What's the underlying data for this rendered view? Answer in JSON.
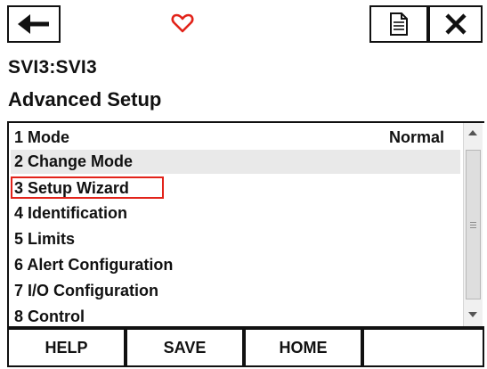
{
  "toolbar": {
    "back_icon": "left-arrow-icon",
    "favorite_icon": "heart-outline-icon",
    "favorite_color": "#e2231a",
    "document_icon": "document-icon",
    "close_icon": "close-x-icon"
  },
  "device_name": "SVI3:SVI3",
  "page_title": "Advanced Setup",
  "menu": {
    "items": [
      {
        "label": "1 Mode",
        "value": "Normal"
      },
      {
        "label": "2 Change Mode",
        "value": ""
      },
      {
        "label": "3 Setup Wizard",
        "value": ""
      },
      {
        "label": "4 Identification",
        "value": ""
      },
      {
        "label": "5 Limits",
        "value": ""
      },
      {
        "label": "6 Alert Configuration",
        "value": ""
      },
      {
        "label": "7 I/O Configuration",
        "value": ""
      },
      {
        "label": "8 Control",
        "value": ""
      }
    ],
    "highlighted_index": 2,
    "highlight_color": "#e2231a"
  },
  "footer": {
    "help_label": "HELP",
    "save_label": "SAVE",
    "home_label": "HOME"
  }
}
